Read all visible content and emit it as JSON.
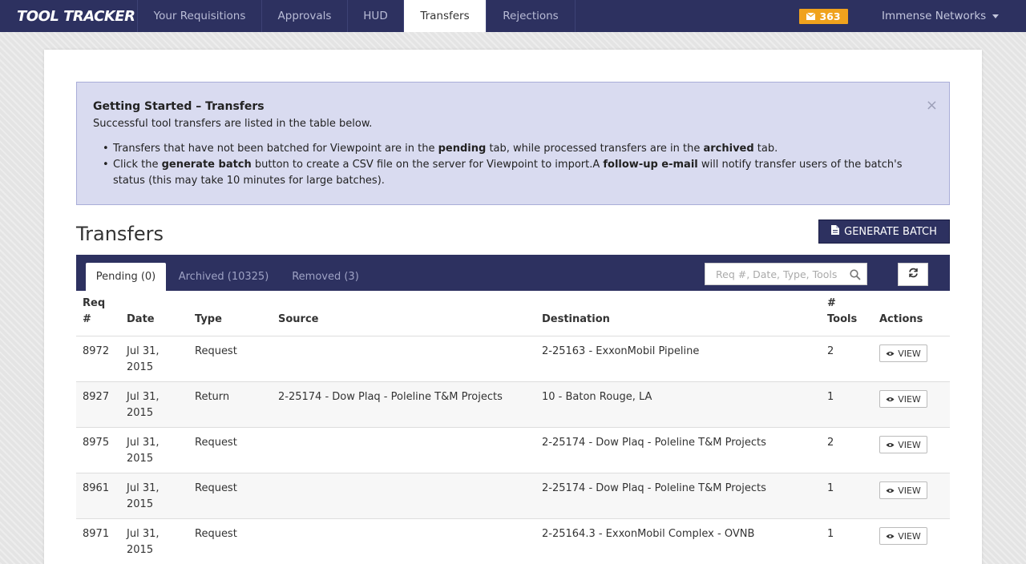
{
  "brand": "TOOL TRACKER",
  "nav": {
    "tabs": [
      "Your Requisitions",
      "Approvals",
      "HUD",
      "Transfers",
      "Rejections"
    ],
    "active": "Transfers",
    "mail_count": "363",
    "org_name": "Immense Networks"
  },
  "alert": {
    "title": "Getting Started – Transfers",
    "intro": "Successful tool transfers are listed in the table below.",
    "bullet1": {
      "a": "Transfers that have not been batched for Viewpoint are in the ",
      "b": "pending",
      "c": " tab, while processed transfers are in the ",
      "d": "archived",
      "e": " tab."
    },
    "bullet2": {
      "a": "Click the ",
      "b": "generate batch",
      "c": " button to create a CSV file on the server for Viewpoint to import.A ",
      "d": "follow-up e-mail",
      "e": " will notify transfer users of the batch's status (this may take 10 minutes for large batches)."
    }
  },
  "page_title": "Transfers",
  "generate_batch_label": "GENERATE BATCH",
  "tabs": {
    "pending": "Pending (0)",
    "archived": "Archived (10325)",
    "removed": "Removed (3)"
  },
  "search": {
    "placeholder": "Req #, Date, Type, Tools"
  },
  "table": {
    "headers": {
      "req": "Req #",
      "date": "Date",
      "type": "Type",
      "source": "Source",
      "destination": "Destination",
      "tools": "# Tools",
      "actions": "Actions"
    },
    "view_label": "VIEW",
    "rows": [
      {
        "req": "8972",
        "date": "Jul 31, 2015",
        "type": "Request",
        "source": "",
        "destination": "2-25163 - ExxonMobil Pipeline",
        "tools": "2"
      },
      {
        "req": "8927",
        "date": "Jul 31, 2015",
        "type": "Return",
        "source": "2-25174 - Dow Plaq - Poleline T&M Projects",
        "destination": "10 - Baton Rouge, LA",
        "tools": "1"
      },
      {
        "req": "8975",
        "date": "Jul 31, 2015",
        "type": "Request",
        "source": "",
        "destination": "2-25174 - Dow Plaq - Poleline T&M Projects",
        "tools": "2"
      },
      {
        "req": "8961",
        "date": "Jul 31, 2015",
        "type": "Request",
        "source": "",
        "destination": "2-25174 - Dow Plaq - Poleline T&M Projects",
        "tools": "1"
      },
      {
        "req": "8971",
        "date": "Jul 31, 2015",
        "type": "Request",
        "source": "",
        "destination": "2-25164.3 - ExxonMobil Complex - OVNB",
        "tools": "1"
      }
    ]
  },
  "colors": {
    "navbar": "#2d3160",
    "badge": "#f0a21d",
    "alert_bg": "#d9dbf0"
  }
}
